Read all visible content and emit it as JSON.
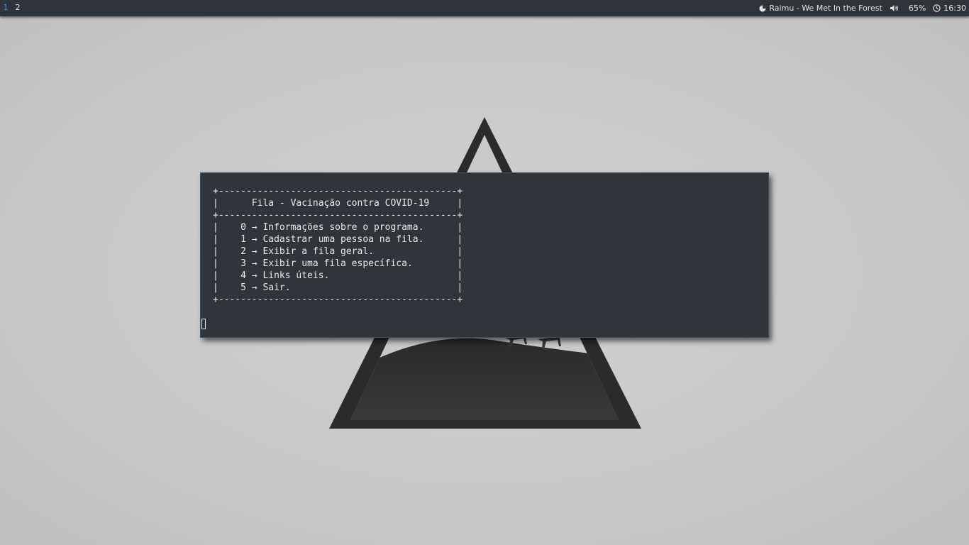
{
  "desktop": {
    "workspaces": [
      "1",
      "2"
    ],
    "active_workspace": "1",
    "accent_color": "#5b8bd6",
    "bar_color": "#2f343a"
  },
  "tray": {
    "music_icon": "music-player-icon",
    "now_playing": "Raimu - We Met In the Forest",
    "volume_icon": "speaker-icon",
    "volume": "65%",
    "clock_icon": "clock-icon",
    "time": "16:30"
  },
  "terminal": {
    "background": "#2f353b",
    "lines": [
      "+-------------------------------------------+",
      "|      Fila - Vacinação contra COVID-19     |",
      "+-------------------------------------------+",
      "|    0 → Informações sobre o programa.      |",
      "|    1 → Cadastrar uma pessoa na fila.      |",
      "|    2 → Exibir a fila geral.               |",
      "|    3 → Exibir uma fila específica.        |",
      "|    4 → Links úteis.                       |",
      "|    5 → Sair.                              |",
      "+-------------------------------------------+"
    ]
  }
}
